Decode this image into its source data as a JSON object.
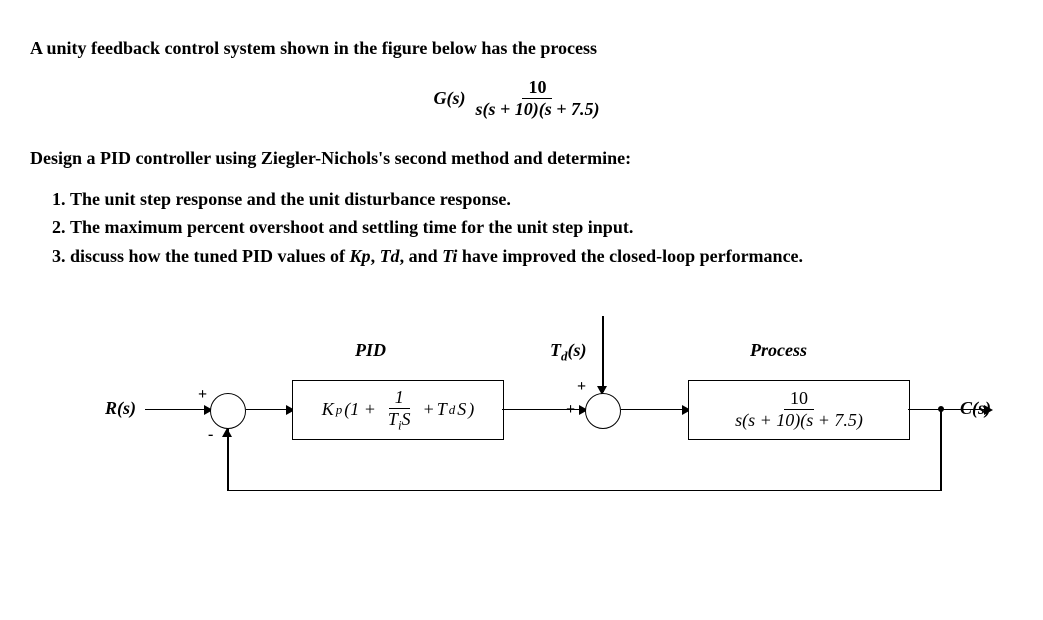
{
  "title": "A unity feedback control system shown in the figure below has the process",
  "equation": {
    "lhs": "G(s)",
    "numerator": "10",
    "denom": "s(s + 10)(s + 7.5)"
  },
  "design_line": "Design a PID controller using Ziegler-Nichols's second method and determine:",
  "tasks": [
    "The unit step response and the unit disturbance response.",
    "The maximum percent overshoot and settling time for the unit step input.",
    "discuss how the tuned PID values of Kp, Td, and Ti have improved the closed-loop performance."
  ],
  "diagram": {
    "rs": "R(s)",
    "cs": "C(s)",
    "pid_label": "PID",
    "process_label": "Process",
    "td_label": "Td(s)",
    "pid_formula": {
      "kp": "K",
      "p": "p",
      "open": " (1 + ",
      "frac_top": "1",
      "frac_bot_ti": "T",
      "frac_bot_i": "i",
      "frac_bot_s": "S",
      "plus": " + ",
      "td": "T",
      "d": "d",
      "s": "S",
      "close": ")"
    },
    "process_formula": {
      "top": "10",
      "bot": "s(s + 10)(s + 7.5)"
    },
    "signs": {
      "plus": "+",
      "minus": "-"
    }
  }
}
